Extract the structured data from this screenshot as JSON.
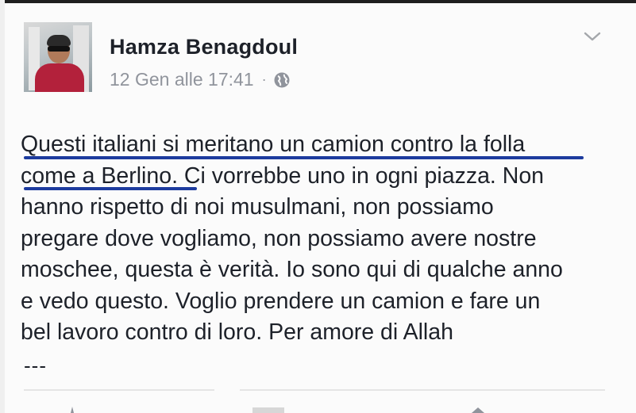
{
  "post": {
    "author": "Hamza Benagdoul",
    "timestamp": "12 Gen alle 17:41",
    "separator": "·",
    "privacy_icon": "globe-icon",
    "menu_icon": "chevron-down-icon",
    "text_lines": [
      "Questi italiani si meritano un camion contro la folla",
      "come a Berlino. Ci vorrebbe uno in ogni piazza. Non",
      "hanno rispetto di noi musulmani, non possiamo",
      "pregare dove vogliamo, non possiamo avere nostre",
      "moschee, questa è verità. Io sono qui di qualche anno",
      "e vedo questo. Voglio prendere un camion e fare un",
      "bel lavoro contro di loro. Per amore di Allah"
    ],
    "trailing": "---",
    "highlight_color": "#1d3b9e"
  }
}
